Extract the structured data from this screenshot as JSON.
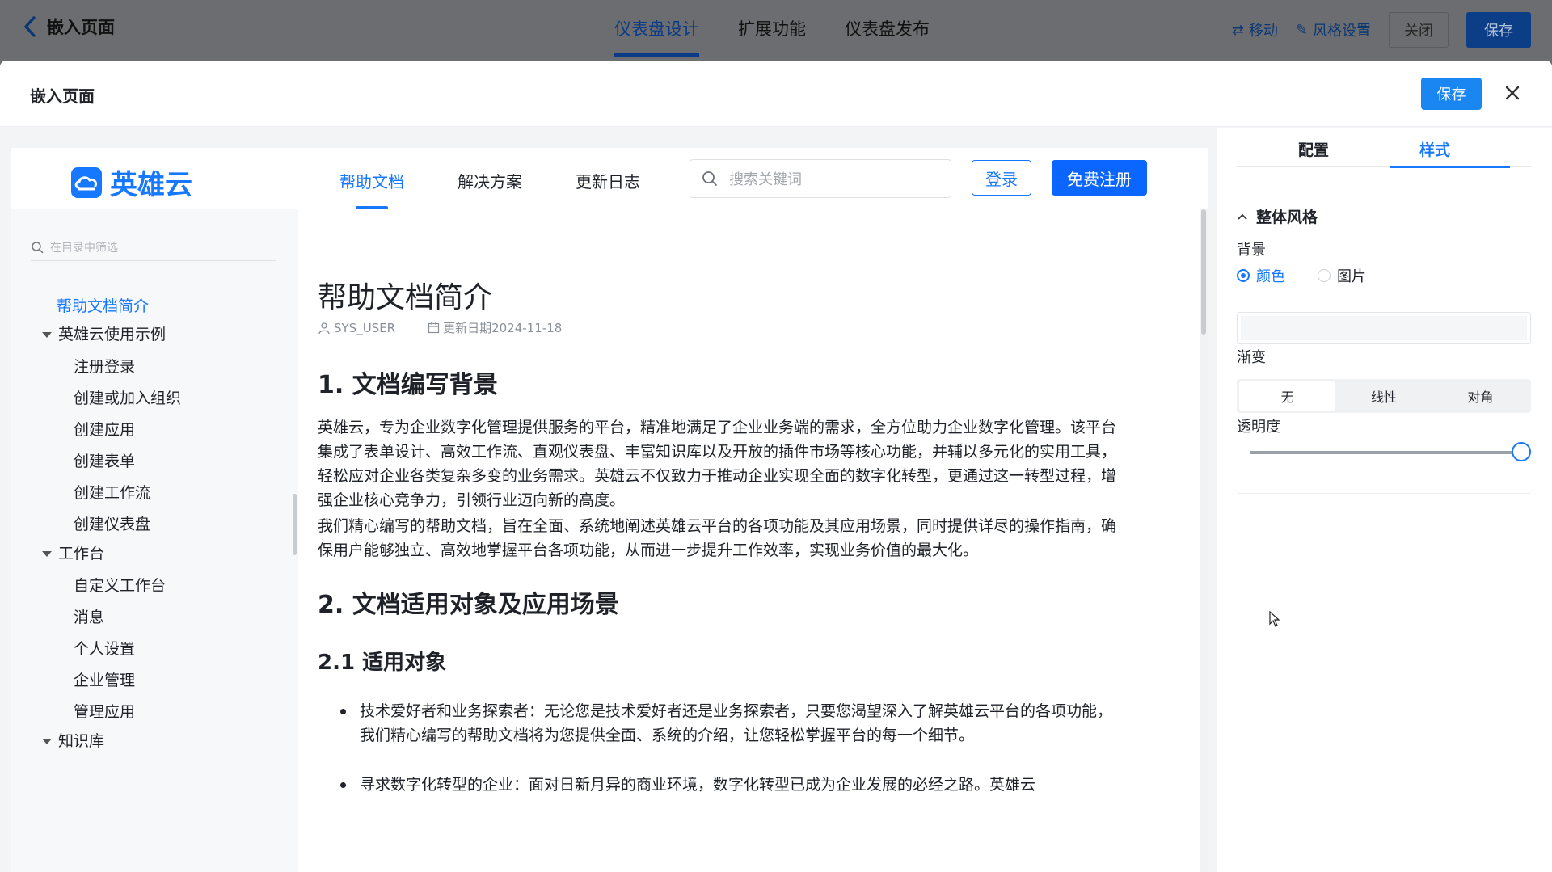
{
  "appbar": {
    "back_label": "嵌入页面",
    "tabs": [
      {
        "label": "仪表盘设计",
        "active": true
      },
      {
        "label": "扩展功能",
        "active": false
      },
      {
        "label": "仪表盘发布",
        "active": false
      }
    ],
    "move_label": "移动",
    "style_label": "风格设置",
    "close_label": "关闭",
    "save_label": "保存"
  },
  "modal": {
    "title": "嵌入页面",
    "save_label": "保存"
  },
  "site": {
    "logo_text": "英雄云",
    "nav": [
      {
        "label": "帮助文档",
        "active": true
      },
      {
        "label": "解决方案",
        "active": false
      },
      {
        "label": "更新日志",
        "active": false
      }
    ],
    "search_placeholder": "搜索关键词",
    "login_label": "登录",
    "register_label": "免费注册"
  },
  "toc": {
    "filter_placeholder": "在目录中筛选",
    "items": [
      {
        "label": "帮助文档简介",
        "level": 0,
        "active": true,
        "caret": false
      },
      {
        "label": "英雄云使用示例",
        "level": 0,
        "active": false,
        "caret": true
      },
      {
        "label": "注册登录",
        "level": 1,
        "active": false,
        "caret": false
      },
      {
        "label": "创建或加入组织",
        "level": 1,
        "active": false,
        "caret": false
      },
      {
        "label": "创建应用",
        "level": 1,
        "active": false,
        "caret": false
      },
      {
        "label": "创建表单",
        "level": 1,
        "active": false,
        "caret": false
      },
      {
        "label": "创建工作流",
        "level": 1,
        "active": false,
        "caret": false
      },
      {
        "label": "创建仪表盘",
        "level": 1,
        "active": false,
        "caret": false
      },
      {
        "label": "工作台",
        "level": 0,
        "active": false,
        "caret": true
      },
      {
        "label": "自定义工作台",
        "level": 1,
        "active": false,
        "caret": false
      },
      {
        "label": "消息",
        "level": 1,
        "active": false,
        "caret": false
      },
      {
        "label": "个人设置",
        "level": 1,
        "active": false,
        "caret": false
      },
      {
        "label": "企业管理",
        "level": 1,
        "active": false,
        "caret": false
      },
      {
        "label": "管理应用",
        "level": 1,
        "active": false,
        "caret": false
      },
      {
        "label": "知识库",
        "level": 0,
        "active": false,
        "caret": true
      }
    ]
  },
  "article": {
    "title": "帮助文档简介",
    "author": "SYS_USER",
    "updated": "更新日期2024-11-18",
    "h1_1": "1. 文档编写背景",
    "p1": "英雄云，专为企业数字化管理提供服务的平台，精准地满足了企业业务端的需求，全方位助力企业数字化管理。该平台集成了表单设计、高效工作流、直观仪表盘、丰富知识库以及开放的插件市场等核心功能，并辅以多元化的实用工具，轻松应对企业各类复杂多变的业务需求。英雄云不仅致力于推动企业实现全面的数字化转型，更通过这一转型过程，增强企业核心竞争力，引领行业迈向新的高度。",
    "p2": "我们精心编写的帮助文档，旨在全面、系统地阐述英雄云平台的各项功能及其应用场景，同时提供详尽的操作指南，确保用户能够独立、高效地掌握平台各项功能，从而进一步提升工作效率，实现业务价值的最大化。",
    "h1_2": "2. 文档适用对象及应用场景",
    "h2_1": "2.1 适用对象",
    "bullets": [
      "技术爱好者和业务探索者：无论您是技术爱好者还是业务探索者，只要您渴望深入了解英雄云平台的各项功能，我们精心编写的帮助文档将为您提供全面、系统的介绍，让您轻松掌握平台的每一个细节。",
      "寻求数字化转型的企业：面对日新月异的商业环境，数字化转型已成为企业发展的必经之路。英雄云"
    ]
  },
  "panel": {
    "tabs": [
      {
        "label": "配置",
        "active": false
      },
      {
        "label": "样式",
        "active": true
      }
    ],
    "section_title": "整体风格",
    "background_label": "背景",
    "radio_color": "颜色",
    "radio_image": "图片",
    "background_mode": "颜色",
    "gradient_label": "渐变",
    "gradient_options": [
      "无",
      "线性",
      "对角"
    ],
    "gradient_selected": "无",
    "opacity_label": "透明度",
    "opacity_value": 1.0
  },
  "colors": {
    "accent": "#1677ff",
    "appbar_dim": "#6c6d70"
  }
}
